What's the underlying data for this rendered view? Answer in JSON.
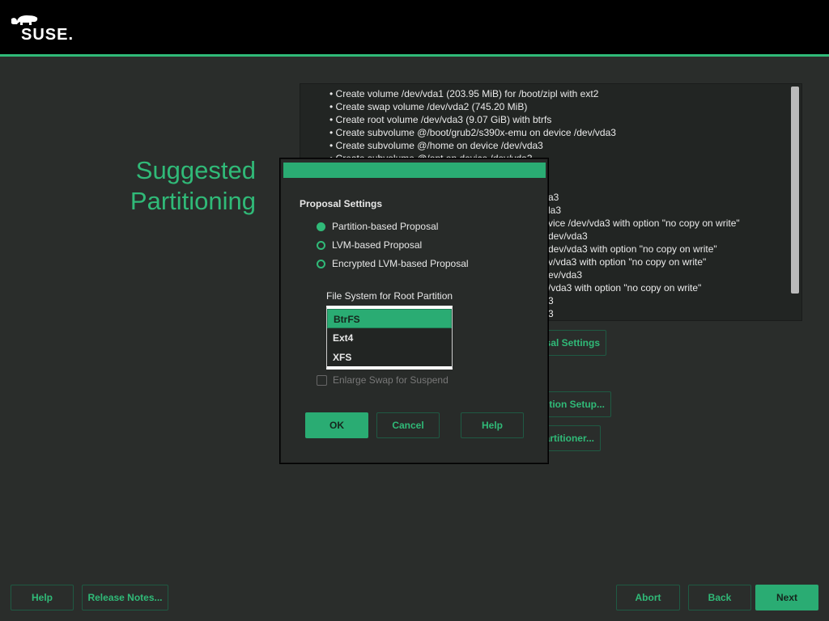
{
  "header": {
    "logo_text": "SUSE."
  },
  "page": {
    "title_line1": "Suggested",
    "title_line2": "Partitioning"
  },
  "log": {
    "lines": [
      "• Create volume /dev/vda1 (203.95 MiB) for /boot/zipl with ext2",
      "• Create swap volume /dev/vda2 (745.20 MiB)",
      "• Create root volume /dev/vda3 (9.07 GiB) with btrfs",
      "• Create subvolume @/boot/grub2/s390x-emu on device /dev/vda3",
      "• Create subvolume @/home on device /dev/vda3",
      "• Create subvolume @/opt on device /dev/vda3"
    ],
    "fragments": [
      "a3",
      "la3",
      "vice /dev/vda3 with option \"no copy on write\"",
      "dev/vda3",
      "dev/vda3 with option \"no copy on write\"",
      "v/vda3 with option \"no copy on write\"",
      "ev/vda3",
      "/vda3 with option \"no copy on write\"",
      "3",
      "3"
    ]
  },
  "background_buttons": {
    "proposal_settings": "sal Settings",
    "partition_setup": "ition Setup...",
    "expert_partitioner": "artitioner..."
  },
  "dialog": {
    "section": "Proposal Settings",
    "options": [
      {
        "label": "Partition-based Proposal",
        "selected": true
      },
      {
        "label": "LVM-based Proposal",
        "selected": false
      },
      {
        "label": "Encrypted LVM-based Proposal",
        "selected": false
      }
    ],
    "fs_label": "File System for Root Partition",
    "fs_options": [
      "BtrFS",
      "Ext4",
      "XFS"
    ],
    "fs_selected": "BtrFS",
    "enlarge_swap": {
      "label": "Enlarge Swap for Suspend",
      "checked": false,
      "enabled": false
    },
    "ok": "OK",
    "cancel": "Cancel",
    "help": "Help"
  },
  "footer": {
    "help": "Help",
    "release_notes": "Release Notes...",
    "abort": "Abort",
    "back": "Back",
    "next": "Next"
  }
}
